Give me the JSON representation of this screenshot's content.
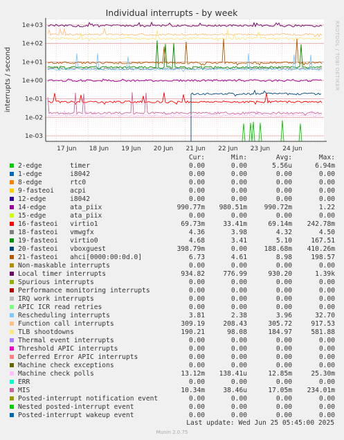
{
  "title": "Individual interrupts - by week",
  "side_text": "RRDTOOL / TOBI OETIKER",
  "footer": "Munin 2.0.75",
  "last_update": "Last update: Wed Jun 25 05:45:00 2025",
  "headers": {
    "cur": "Cur:",
    "min": "Min:",
    "avg": "Avg:",
    "max": "Max:"
  },
  "chart_data": {
    "type": "line",
    "title": "Individual interrupts - by week",
    "ylabel": "interrupts / second",
    "yscale": "log",
    "ylim": [
      0.0005,
      2000
    ],
    "yticks": [
      "1e-03",
      "1e-02",
      "1e-01",
      "1e+00",
      "1e+01",
      "1e+02",
      "1e+03"
    ],
    "xticks": [
      "17 Jun",
      "18 Jun",
      "19 Jun",
      "20 Jun",
      "21 Jun",
      "22 Jun",
      "23 Jun",
      "24 Jun"
    ],
    "grid": true,
    "series": [
      {
        "name": "2-edge",
        "label": "timer",
        "color": "#00cc00",
        "cur": "0.00",
        "min": "0.00",
        "avg": "5.56u",
        "max": "6.94m"
      },
      {
        "name": "1-edge",
        "label": "i8042",
        "color": "#0066b3",
        "cur": "0.00",
        "min": "0.00",
        "avg": "0.00",
        "max": "0.00"
      },
      {
        "name": "8-edge",
        "label": "rtc0",
        "color": "#ff8000",
        "cur": "0.00",
        "min": "0.00",
        "avg": "0.00",
        "max": "0.00"
      },
      {
        "name": "9-fasteoi",
        "label": "acpi",
        "color": "#ffcc00",
        "cur": "0.00",
        "min": "0.00",
        "avg": "0.00",
        "max": "0.00"
      },
      {
        "name": "12-edge",
        "label": "i8042",
        "color": "#330099",
        "cur": "0.00",
        "min": "0.00",
        "avg": "0.00",
        "max": "0.00"
      },
      {
        "name": "14-edge",
        "label": "ata_piix",
        "color": "#990099",
        "cur": "990.77m",
        "min": "980.51m",
        "avg": "990.72m",
        "max": "1.22"
      },
      {
        "name": "15-edge",
        "label": "ata_piix",
        "color": "#ccff00",
        "cur": "0.00",
        "min": "0.00",
        "avg": "0.00",
        "max": "0.00"
      },
      {
        "name": "16-fasteoi",
        "label": "virtio1",
        "color": "#ff0000",
        "cur": "69.73m",
        "min": "33.41m",
        "avg": "69.14m",
        "max": "242.78m"
      },
      {
        "name": "18-fasteoi",
        "label": "vmwgfx",
        "color": "#808080",
        "cur": "4.36",
        "min": "3.98",
        "avg": "4.32",
        "max": "4.50"
      },
      {
        "name": "19-fasteoi",
        "label": "virtio0",
        "color": "#008f00",
        "cur": "4.68",
        "min": "3.41",
        "avg": "5.10",
        "max": "167.51"
      },
      {
        "name": "20-fasteoi",
        "label": "vboxguest",
        "color": "#00487d",
        "cur": "398.79m",
        "min": "0.00",
        "avg": "188.68m",
        "max": "410.26m"
      },
      {
        "name": "21-fasteoi",
        "label": "ahci[0000:00:0d.0]",
        "color": "#b35a00",
        "cur": "6.73",
        "min": "4.61",
        "avg": "8.98",
        "max": "198.57"
      },
      {
        "name": "Non-maskable interrupts",
        "label": "",
        "color": "#b38f00",
        "cur": "0.00",
        "min": "0.00",
        "avg": "0.00",
        "max": "0.00"
      },
      {
        "name": "Local timer interrupts",
        "label": "",
        "color": "#6b006b",
        "cur": "934.82",
        "min": "776.99",
        "avg": "930.20",
        "max": "1.39k"
      },
      {
        "name": "Spurious interrupts",
        "label": "",
        "color": "#8fb300",
        "cur": "0.00",
        "min": "0.00",
        "avg": "0.00",
        "max": "0.00"
      },
      {
        "name": "Performance monitoring interrupts",
        "label": "",
        "color": "#b30000",
        "cur": "0.00",
        "min": "0.00",
        "avg": "0.00",
        "max": "0.00"
      },
      {
        "name": "IRQ work interrupts",
        "label": "",
        "color": "#bebebe",
        "cur": "0.00",
        "min": "0.00",
        "avg": "0.00",
        "max": "0.00"
      },
      {
        "name": "APIC ICR read retries",
        "label": "",
        "color": "#80ff80",
        "cur": "0.00",
        "min": "0.00",
        "avg": "0.00",
        "max": "0.00"
      },
      {
        "name": "Rescheduling interrupts",
        "label": "",
        "color": "#80c9ff",
        "cur": "3.81",
        "min": "2.38",
        "avg": "3.96",
        "max": "32.70"
      },
      {
        "name": "Function call interrupts",
        "label": "",
        "color": "#ffc080",
        "cur": "309.19",
        "min": "208.43",
        "avg": "305.72",
        "max": "917.53"
      },
      {
        "name": "TLB shootdowns",
        "label": "",
        "color": "#ffe680",
        "cur": "190.21",
        "min": "98.08",
        "avg": "184.97",
        "max": "581.88"
      },
      {
        "name": "Thermal event interrupts",
        "label": "",
        "color": "#aa80ff",
        "cur": "0.00",
        "min": "0.00",
        "avg": "0.00",
        "max": "0.00"
      },
      {
        "name": "Threshold APIC interrupts",
        "label": "",
        "color": "#ee00cc",
        "cur": "0.00",
        "min": "0.00",
        "avg": "0.00",
        "max": "0.00"
      },
      {
        "name": "Deferred Error APIC interrupts",
        "label": "",
        "color": "#ff8080",
        "cur": "0.00",
        "min": "0.00",
        "avg": "0.00",
        "max": "0.00"
      },
      {
        "name": "Machine check exceptions",
        "label": "",
        "color": "#666600",
        "cur": "0.00",
        "min": "0.00",
        "avg": "0.00",
        "max": "0.00"
      },
      {
        "name": "Machine check polls",
        "label": "",
        "color": "#ffbfff",
        "cur": "13.12m",
        "min": "138.41u",
        "avg": "12.85m",
        "max": "25.30m"
      },
      {
        "name": "ERR",
        "label": "",
        "color": "#00ffcc",
        "cur": "0.00",
        "min": "0.00",
        "avg": "0.00",
        "max": "0.00"
      },
      {
        "name": "MIS",
        "label": "",
        "color": "#cc6699",
        "cur": "10.34m",
        "min": "38.46u",
        "avg": "17.05m",
        "max": "234.01m"
      },
      {
        "name": "Posted-interrupt notification event",
        "label": "",
        "color": "#999900",
        "cur": "0.00",
        "min": "0.00",
        "avg": "0.00",
        "max": "0.00"
      },
      {
        "name": "Nested posted-interrupt event",
        "label": "",
        "color": "#00cc00",
        "cur": "0.00",
        "min": "0.00",
        "avg": "0.00",
        "max": "0.00"
      },
      {
        "name": "Posted-interrupt wakeup event",
        "label": "",
        "color": "#0066b3",
        "cur": "0.00",
        "min": "0.00",
        "avg": "0.00",
        "max": "0.00"
      }
    ]
  }
}
